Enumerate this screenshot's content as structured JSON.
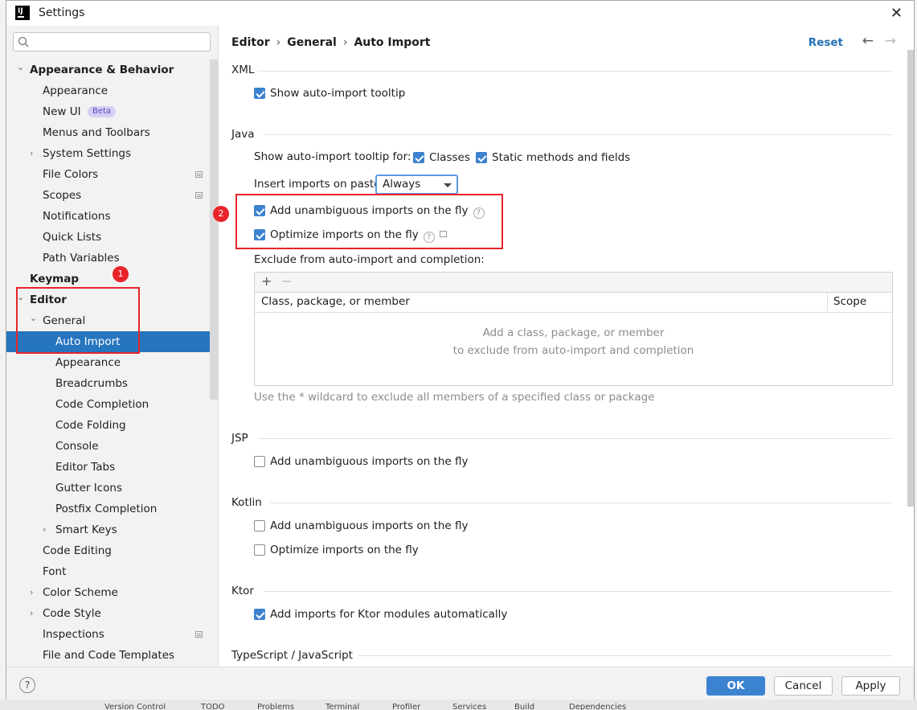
{
  "window": {
    "title": "Settings",
    "close_icon": "close-icon"
  },
  "search": {
    "placeholder": "Q-",
    "value": ""
  },
  "sidebar": {
    "items": [
      {
        "label": "Appearance & Behavior",
        "level": 0,
        "expanded": true,
        "bold": true
      },
      {
        "label": "Appearance",
        "level": 1
      },
      {
        "label": "New UI",
        "level": 1,
        "badge": "Beta"
      },
      {
        "label": "Menus and Toolbars",
        "level": 1
      },
      {
        "label": "System Settings",
        "level": 1,
        "collapsed": true
      },
      {
        "label": "File Colors",
        "level": 1,
        "project_icon": true
      },
      {
        "label": "Scopes",
        "level": 1,
        "project_icon": true
      },
      {
        "label": "Notifications",
        "level": 1
      },
      {
        "label": "Quick Lists",
        "level": 1
      },
      {
        "label": "Path Variables",
        "level": 1
      },
      {
        "label": "Keymap",
        "level": 0,
        "bold": true
      },
      {
        "label": "Editor",
        "level": 0,
        "expanded": true,
        "bold": true
      },
      {
        "label": "General",
        "level": 1,
        "expanded": true
      },
      {
        "label": "Auto Import",
        "level": 2,
        "selected": true
      },
      {
        "label": "Appearance",
        "level": 2
      },
      {
        "label": "Breadcrumbs",
        "level": 2
      },
      {
        "label": "Code Completion",
        "level": 2
      },
      {
        "label": "Code Folding",
        "level": 2
      },
      {
        "label": "Console",
        "level": 2
      },
      {
        "label": "Editor Tabs",
        "level": 2
      },
      {
        "label": "Gutter Icons",
        "level": 2
      },
      {
        "label": "Postfix Completion",
        "level": 2
      },
      {
        "label": "Smart Keys",
        "level": 2,
        "collapsed": true
      },
      {
        "label": "Code Editing",
        "level": 1
      },
      {
        "label": "Font",
        "level": 1
      },
      {
        "label": "Color Scheme",
        "level": 1,
        "collapsed": true
      },
      {
        "label": "Code Style",
        "level": 1,
        "collapsed": true
      },
      {
        "label": "Inspections",
        "level": 1,
        "project_icon": true
      },
      {
        "label": "File and Code Templates",
        "level": 1
      }
    ]
  },
  "header": {
    "breadcrumb": [
      "Editor",
      "General",
      "Auto Import"
    ],
    "reset_label": "Reset",
    "back_icon": "arrow-left-icon",
    "forward_icon": "arrow-right-icon"
  },
  "xml": {
    "title": "XML",
    "show_tooltip": {
      "label": "Show auto-import tooltip",
      "checked": true
    }
  },
  "java": {
    "title": "Java",
    "tooltip_for_label": "Show auto-import tooltip for:",
    "classes": {
      "label": "Classes",
      "checked": true
    },
    "static_methods": {
      "label": "Static methods and fields",
      "checked": true
    },
    "insert_on_paste_label": "Insert imports on paste:",
    "insert_on_paste_value": "Always",
    "add_unambiguous": {
      "label": "Add unambiguous imports on the fly",
      "checked": true
    },
    "optimize": {
      "label": "Optimize imports on the fly",
      "checked": true
    },
    "exclude_label": "Exclude from auto-import and completion:",
    "table": {
      "add_label": "+",
      "remove_label": "−",
      "columns": [
        "Class, package, or member",
        "Scope"
      ],
      "empty_line1": "Add a class, package, or member",
      "empty_line2": "to exclude from auto-import and completion"
    },
    "wildcard_hint": "Use the * wildcard to exclude all members of a specified class or package"
  },
  "jsp": {
    "title": "JSP",
    "add_unambiguous": {
      "label": "Add unambiguous imports on the fly",
      "checked": false
    }
  },
  "kotlin": {
    "title": "Kotlin",
    "add_unambiguous": {
      "label": "Add unambiguous imports on the fly",
      "checked": false
    },
    "optimize": {
      "label": "Optimize imports on the fly",
      "checked": false
    }
  },
  "ktor": {
    "title": "Ktor",
    "add_imports": {
      "label": "Add imports for Ktor modules automatically",
      "checked": true
    }
  },
  "typescript": {
    "title": "TypeScript / JavaScript"
  },
  "footer": {
    "help_label": "?",
    "ok_label": "OK",
    "cancel_label": "Cancel",
    "apply_label": "Apply"
  },
  "annotations": {
    "badge1": "1",
    "badge2": "2"
  },
  "background_bar": [
    "Version Control",
    "TODO",
    "Problems",
    "Terminal",
    "Profiler",
    "Services",
    "Build",
    "Dependencies"
  ],
  "colors": {
    "accent": "#2675bf",
    "annotation": "#e8242a",
    "ok_button": "#3b82d1",
    "link": "#2470b3"
  }
}
